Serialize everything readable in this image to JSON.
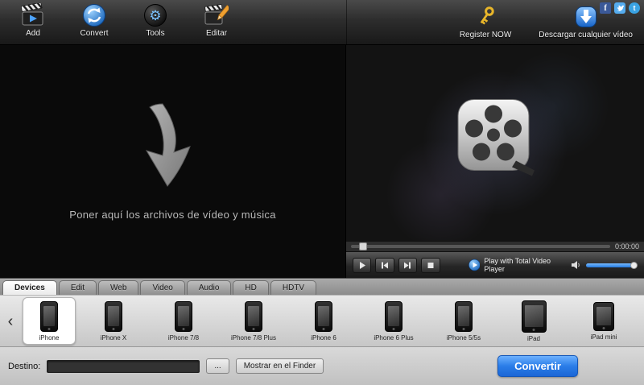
{
  "toolbar": {
    "items": [
      {
        "label": "Add"
      },
      {
        "label": "Convert"
      },
      {
        "label": "Tools"
      },
      {
        "label": "Editar"
      }
    ],
    "register_label": "Register NOW",
    "download_label": "Descargar cualquier vídeo"
  },
  "social_icons": [
    "facebook",
    "twitter-bird",
    "twitter"
  ],
  "drop_zone": {
    "hint": "Poner aquí los archivos de vídeo y música"
  },
  "player": {
    "time": "0:00:00",
    "branding": "Play with Total Video Player"
  },
  "tabs": [
    {
      "label": "Devices",
      "active": true
    },
    {
      "label": "Edit",
      "active": false
    },
    {
      "label": "Web",
      "active": false
    },
    {
      "label": "Video",
      "active": false
    },
    {
      "label": "Audio",
      "active": false
    },
    {
      "label": "HD",
      "active": false
    },
    {
      "label": "HDTV",
      "active": false
    }
  ],
  "carousel": {
    "prev": "‹",
    "devices": [
      {
        "label": "iPhone",
        "selected": true
      },
      {
        "label": "iPhone X",
        "selected": false
      },
      {
        "label": "iPhone 7/8",
        "selected": false
      },
      {
        "label": "iPhone 7/8 Plus",
        "selected": false
      },
      {
        "label": "iPhone 6",
        "selected": false
      },
      {
        "label": "iPhone 6 Plus",
        "selected": false
      },
      {
        "label": "iPhone 5/5s",
        "selected": false
      },
      {
        "label": "iPad",
        "selected": false
      },
      {
        "label": "iPad mini",
        "selected": false
      }
    ]
  },
  "destination": {
    "label": "Destino:",
    "value": "",
    "browse": "...",
    "finder": "Mostrar en el Finder"
  },
  "actions": {
    "convert": "Convertir"
  },
  "colors": {
    "accent": "#2a7de8",
    "facebook": "#3b5998",
    "twitter": "#55acee",
    "key_gold": "#e8b62a"
  }
}
